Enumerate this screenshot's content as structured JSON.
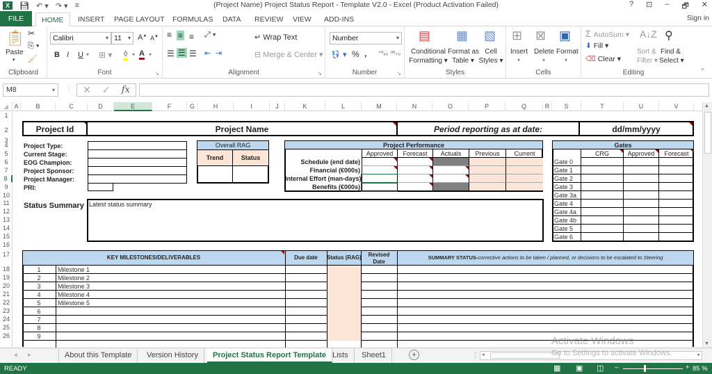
{
  "window": {
    "title": "(Project Name) Project Status Report - Template V2.0 - Excel (Product Activation Failed)",
    "controls": {
      "help": "?",
      "display": "⊡",
      "minimize": "–",
      "restore": "🗗",
      "close": "✕"
    }
  },
  "ribbon_tabs": [
    "FILE",
    "HOME",
    "INSERT",
    "PAGE LAYOUT",
    "FORMULAS",
    "DATA",
    "REVIEW",
    "VIEW",
    "ADD-INS"
  ],
  "sign_in": "Sign in",
  "ribbon": {
    "clipboard": {
      "label": "Clipboard",
      "paste": "Paste"
    },
    "font": {
      "label": "Font",
      "name": "Calibri",
      "size": "11",
      "bold": "B",
      "italic": "I",
      "underline": "U"
    },
    "alignment": {
      "label": "Alignment",
      "wrap_text": "Wrap Text",
      "merge_center": "Merge & Center"
    },
    "number": {
      "label": "Number",
      "format": "Number",
      "percent": "%",
      "comma": ","
    },
    "styles": {
      "label": "Styles",
      "conditional_formatting": [
        "Conditional",
        "Formatting ▾"
      ],
      "format_as_table": [
        "Format as",
        "Table ▾"
      ],
      "cell_styles": [
        "Cell",
        "Styles ▾"
      ]
    },
    "cells": {
      "label": "Cells",
      "insert": "Insert",
      "delete": "Delete",
      "format": "Format"
    },
    "editing": {
      "label": "Editing",
      "autosum": "AutoSum",
      "fill": "Fill",
      "clear": "Clear",
      "sort_filter": [
        "Sort &",
        "Filter ▾"
      ],
      "find_select": [
        "Find &",
        "Select ▾"
      ]
    }
  },
  "formula_bar": {
    "name_box": "M8",
    "formula": "",
    "fx": "fx"
  },
  "columns": [
    "A",
    "B",
    "C",
    "D",
    "E",
    "F",
    "G",
    "H",
    "I",
    "J",
    "K",
    "L",
    "M",
    "N",
    "O",
    "P",
    "Q",
    "R",
    "S",
    "T",
    "U",
    "V"
  ],
  "selected_column": "M",
  "rows": [
    "1",
    "2",
    "3",
    "4",
    "5",
    "6",
    "7",
    "8",
    "9",
    "10",
    "11",
    "12",
    "13",
    "14",
    "15",
    "16",
    "17",
    "18",
    "19",
    "20",
    "21",
    "22",
    "23",
    "24",
    "25",
    "26"
  ],
  "selected_row": "8",
  "sheet": {
    "project_id": "Project Id",
    "project_name": "Project Name",
    "period_label": "Period reporting as at date:",
    "period_date": "dd/mm/yyyy",
    "info_labels": [
      "Project Type:",
      "Current Stage:",
      "EOG Champion:",
      "Project Sponsor:",
      "Project Manager:",
      "PRI:"
    ],
    "overall_rag": {
      "title": "Overall RAG",
      "trend": "Trend",
      "status": "Status"
    },
    "performance": {
      "title": "Project Performance",
      "columns": [
        "Approved",
        "Forecast",
        "Actuals",
        "Previous",
        "Current"
      ],
      "rows": [
        "Schedule (end date)",
        "Financial (€000s)",
        "Internal Effort (man-days)",
        "Benefits (€000s)"
      ]
    },
    "gates": {
      "title": "Gates",
      "columns": [
        "CRG",
        "Approved",
        "Forecast"
      ],
      "rows": [
        "Gate 0",
        "Gate 1",
        "Gate 2",
        "Gate 3",
        "Gate 3a",
        "Gate 4",
        "Gate 4a",
        "Gate 4b",
        "Gate 5",
        "Gate 6"
      ]
    },
    "status_summary": {
      "label": "Status Summary",
      "text": "Latest status summary"
    },
    "milestones": {
      "header": "KEY MILESTONES/DELIVERABLES",
      "due_date": "Due date",
      "status_rag": "Status (RAG)",
      "revised_date": "Revised Date",
      "summary_bold": "SUMMARY STATUS-",
      "summary_italic": "corrective actions to be taken / planned, or decisions to be escalated to Steering",
      "rows": [
        {
          "num": "1",
          "name": "Milestone 1"
        },
        {
          "num": "2",
          "name": "Milestone 2"
        },
        {
          "num": "3",
          "name": "Milestone 3"
        },
        {
          "num": "4",
          "name": "Milestone 4"
        },
        {
          "num": "5",
          "name": "Milestone 5"
        },
        {
          "num": "6",
          "name": ""
        },
        {
          "num": "7",
          "name": ""
        },
        {
          "num": "8",
          "name": ""
        },
        {
          "num": "9",
          "name": ""
        }
      ]
    }
  },
  "sheet_tabs": [
    "About this Template",
    "Version History",
    "Project Status Report Template",
    "Lists",
    "Sheet1"
  ],
  "active_sheet": "Project Status Report Template",
  "status": {
    "ready": "READY",
    "zoom": "85 %"
  },
  "watermark": {
    "line1": "Activate Windows",
    "line2": "Go to Settings to activate Windows."
  }
}
